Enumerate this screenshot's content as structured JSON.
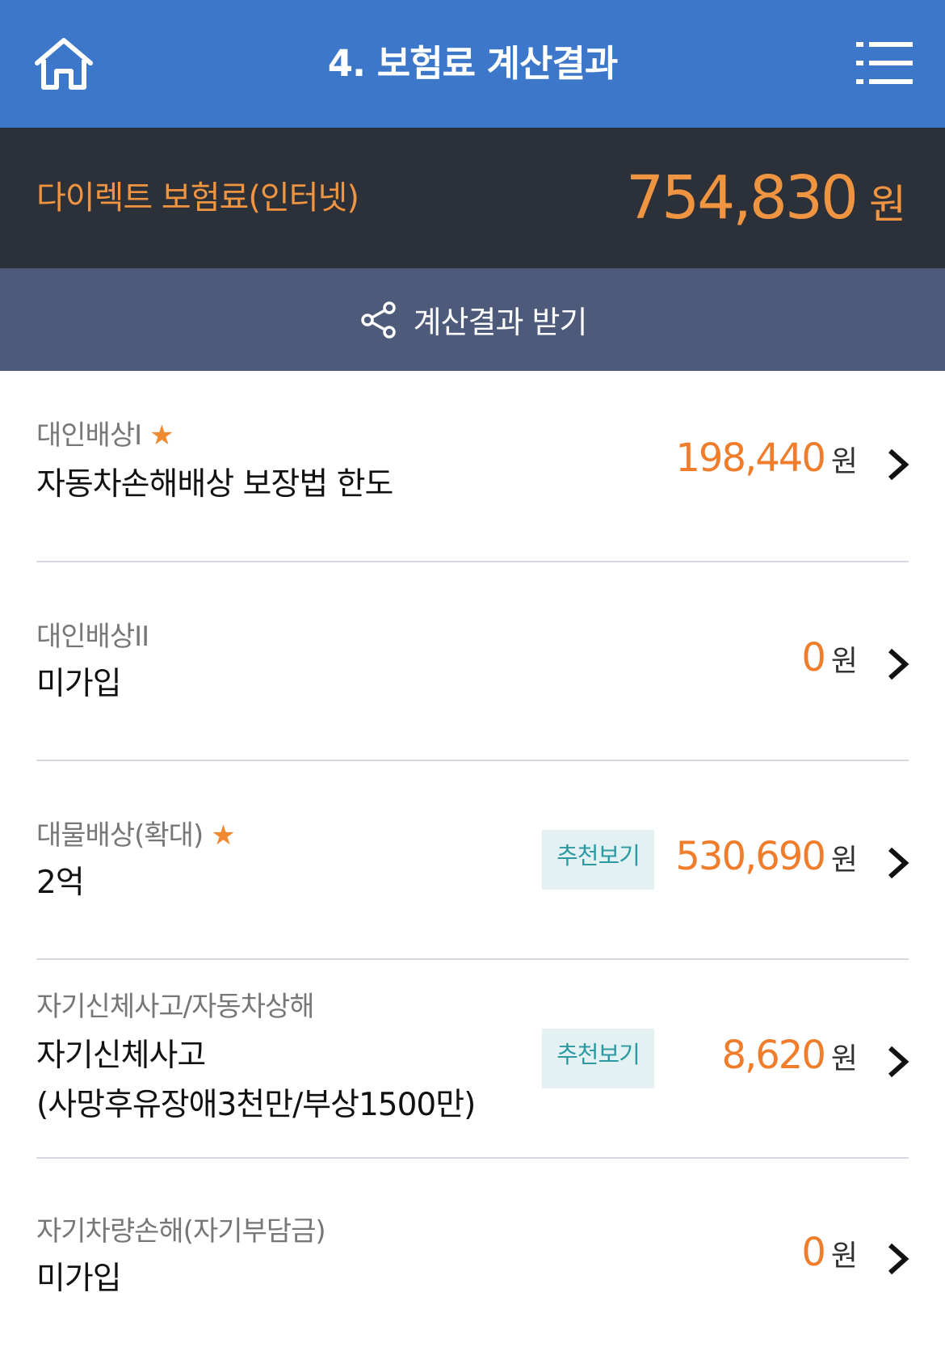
{
  "header": {
    "title": "4. 보험료 계산결과",
    "home_icon": "home-icon",
    "menu_icon": "menu-list-icon",
    "background": "#3c77c9"
  },
  "summary": {
    "label": "다이렉트 보험료(인터넷)",
    "amount": "754,830",
    "unit": "원",
    "accent": "#ef9440"
  },
  "share": {
    "label": "계산결과 받기",
    "icon": "share-icon"
  },
  "coverages": [
    {
      "category": "대인배상I",
      "required": "★",
      "value": "자동차손해배상 보장법 한도",
      "amount": "198,440",
      "unit": "원"
    },
    {
      "category": "대인배상II",
      "value": "미가입",
      "amount": "0",
      "unit": "원"
    },
    {
      "category": "대물배상(확대)",
      "required": "★",
      "value": "2억",
      "recommend": "추천보기",
      "amount": "530,690",
      "unit": "원"
    },
    {
      "category": "자기신체사고/자동차상해",
      "value": "자기신체사고",
      "value2": "(사망후유장애3천만/부상1500만)",
      "recommend": "추천보기",
      "amount": "8,620",
      "unit": "원"
    },
    {
      "category": "자기차량손해(자기부담금)",
      "value": "미가입",
      "amount": "0",
      "unit": "원"
    }
  ]
}
